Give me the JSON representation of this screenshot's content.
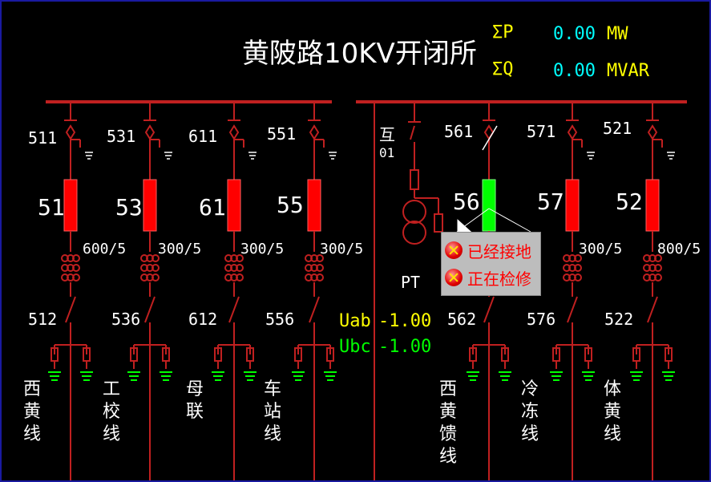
{
  "header": {
    "title": "黄陂路10KV开闭所",
    "sum_p_label": "ΣP",
    "sum_p_value": "0.00",
    "sum_p_unit": "MW",
    "sum_q_label": "ΣQ",
    "sum_q_value": "0.00",
    "sum_q_unit": "MVAR"
  },
  "measurements": {
    "uab_label": "Uab",
    "uab_value": "-1.00",
    "ubc_label": "Ubc",
    "ubc_value": "-1.00"
  },
  "pt_label": "PT",
  "pt_switch": {
    "label_top": "互",
    "label_bottom": "01"
  },
  "feeders": [
    {
      "top_switch": "511",
      "breaker": "51",
      "ct_ratio": "600/5",
      "bottom_switch": "512",
      "name": "西黄线",
      "breaker_state": "closed"
    },
    {
      "top_switch": "531",
      "breaker": "53",
      "ct_ratio": "300/5",
      "bottom_switch": "536",
      "name": "工校线",
      "breaker_state": "closed"
    },
    {
      "top_switch": "611",
      "breaker": "61",
      "ct_ratio": "300/5",
      "bottom_switch": "612",
      "name": "母联",
      "breaker_state": "closed"
    },
    {
      "top_switch": "551",
      "breaker": "55",
      "ct_ratio": "300/5",
      "bottom_switch": "556",
      "name": "车站线",
      "breaker_state": "closed"
    },
    {
      "top_switch": "561",
      "breaker": "56",
      "ct_ratio": "",
      "bottom_switch": "562",
      "name": "西黄馈线",
      "breaker_state": "open"
    },
    {
      "top_switch": "571",
      "breaker": "57",
      "ct_ratio": "300/5",
      "bottom_switch": "576",
      "name": "冷冻线",
      "breaker_state": "closed"
    },
    {
      "top_switch": "521",
      "breaker": "52",
      "ct_ratio": "800/5",
      "bottom_switch": "522",
      "name": "体黄线",
      "breaker_state": "closed"
    }
  ],
  "tooltip": {
    "items": [
      "已经接地",
      "正在检修"
    ]
  },
  "colors": {
    "background": "#000000",
    "bus": "#c02020",
    "breaker_closed": "#ff0000",
    "breaker_open": "#00ff00",
    "title": "#ffffff",
    "measure_label": "#ffff00",
    "measure_value": "#00ffff"
  }
}
